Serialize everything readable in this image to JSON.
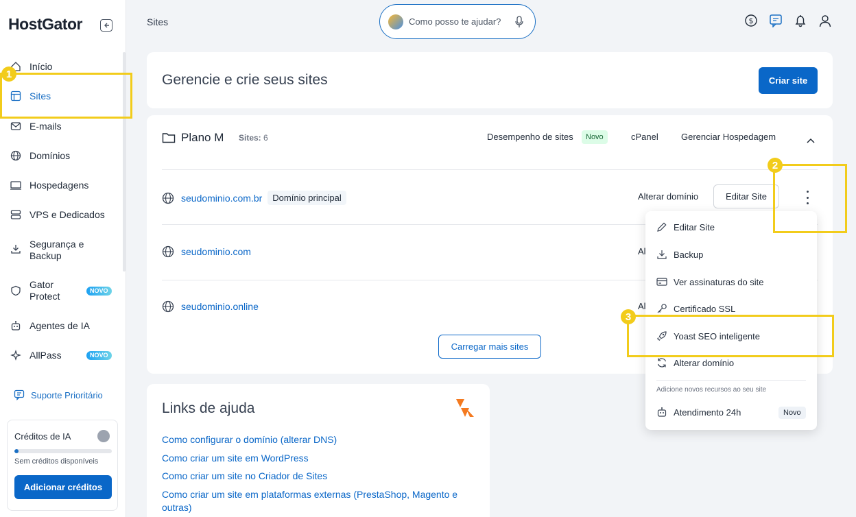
{
  "brand": {
    "logo": "HostGator"
  },
  "sidebar": {
    "items": [
      {
        "label": "Início",
        "icon": "home-icon"
      },
      {
        "label": "Sites",
        "icon": "layout-icon"
      },
      {
        "label": "E-mails",
        "icon": "mail-icon"
      },
      {
        "label": "Domínios",
        "icon": "globe-icon"
      },
      {
        "label": "Hospedagens",
        "icon": "laptop-icon"
      },
      {
        "label": "VPS e Dedicados",
        "icon": "server-icon"
      },
      {
        "label": "Segurança e Backup",
        "icon": "download-icon"
      },
      {
        "label": "Gator Protect",
        "icon": "shield-icon",
        "badge": "NOVO"
      },
      {
        "label": "Agentes de IA",
        "icon": "robot-icon"
      },
      {
        "label": "AllPass",
        "icon": "sparkle-icon",
        "badge": "NOVO"
      }
    ],
    "support": "Suporte Prioritário",
    "credits": {
      "title": "Créditos de IA",
      "subtitle": "Sem créditos disponíveis",
      "button": "Adicionar créditos",
      "level": 0.04
    }
  },
  "topbar": {
    "breadcrumb": "Sites",
    "search_placeholder": "Como posso te ajudar?",
    "icons": [
      "dollar-icon",
      "chat-icon",
      "bell-icon",
      "user-icon"
    ]
  },
  "header_card": {
    "title": "Gerencie e crie seus sites",
    "button": "Criar site"
  },
  "plan": {
    "name": "Plano M",
    "sites_label": "Sites:",
    "sites_count": "6",
    "links": {
      "performance": "Desempenho de sites",
      "performance_badge": "Novo",
      "cpanel": "cPanel",
      "manage": "Gerenciar Hospedagem"
    },
    "sites": [
      {
        "domain": "seudominio.com.br",
        "tag": "Domínio principal"
      },
      {
        "domain": "seudominio.com"
      },
      {
        "domain": "seudominio.online"
      }
    ],
    "change_domain": "Alterar domínio",
    "change_domain_clipped": "Al",
    "edit_site": "Editar Site",
    "load_more": "Carregar mais sites"
  },
  "help": {
    "title": "Links de ajuda",
    "links": [
      "Como configurar o domínio (alterar DNS)",
      "Como criar um site em WordPress",
      "Como criar um site no Criador de Sites",
      "Como criar um site em plataformas externas (PrestaShop, Magento e outras)"
    ]
  },
  "menu": {
    "items": [
      {
        "label": "Editar Site",
        "icon": "pencil-icon"
      },
      {
        "label": "Backup",
        "icon": "download-icon"
      },
      {
        "label": "Ver assinaturas do site",
        "icon": "card-icon"
      },
      {
        "label": "Certificado SSL",
        "icon": "key-icon"
      },
      {
        "label": "Yoast SEO inteligente",
        "icon": "rocket-icon"
      },
      {
        "label": "Alterar domínio",
        "icon": "refresh-icon"
      }
    ],
    "hint": "Adicione novos recursos ao seu site",
    "extra": {
      "label": "Atendimento 24h",
      "badge": "Novo"
    }
  },
  "annotations": [
    "1",
    "2",
    "3"
  ],
  "colors": {
    "accent": "#0a67c8",
    "highlight": "#f2cc1b"
  }
}
